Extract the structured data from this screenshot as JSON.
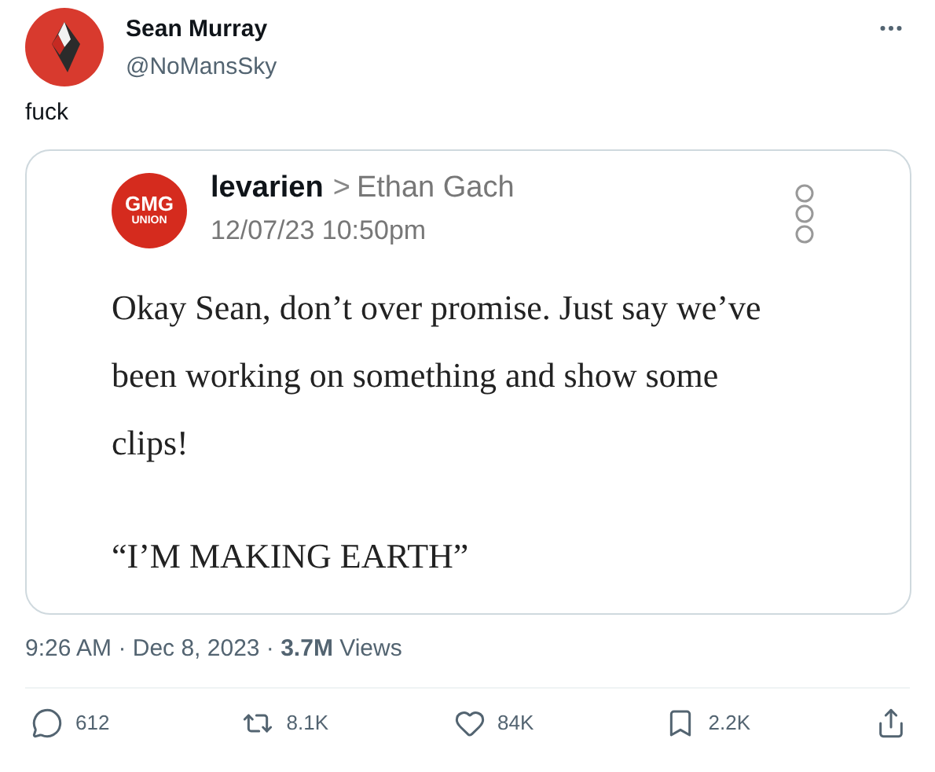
{
  "author": {
    "name": "Sean Murray",
    "handle": "@NoMansSky"
  },
  "text": "fuck",
  "quoted_image": {
    "user": "levarien",
    "separator": ">",
    "recipient": "Ethan Gach",
    "date": "12/07/23 10:50pm",
    "avatar_lines": [
      "GMG",
      "UNION"
    ],
    "body": [
      "Okay Sean, don’t over promise. Just say we’ve been working on something and show some clips!",
      "“I’M MAKING EARTH”"
    ]
  },
  "meta": "9:26 AM · Dec 8, 2023 · **3.7M** Views",
  "actions": [
    {
      "kind": "reply",
      "count": "612"
    },
    {
      "kind": "retweet",
      "count": "8.1K"
    },
    {
      "kind": "like",
      "count": "84K"
    },
    {
      "kind": "bookmark",
      "count": "2.2K"
    },
    {
      "kind": "share"
    }
  ]
}
